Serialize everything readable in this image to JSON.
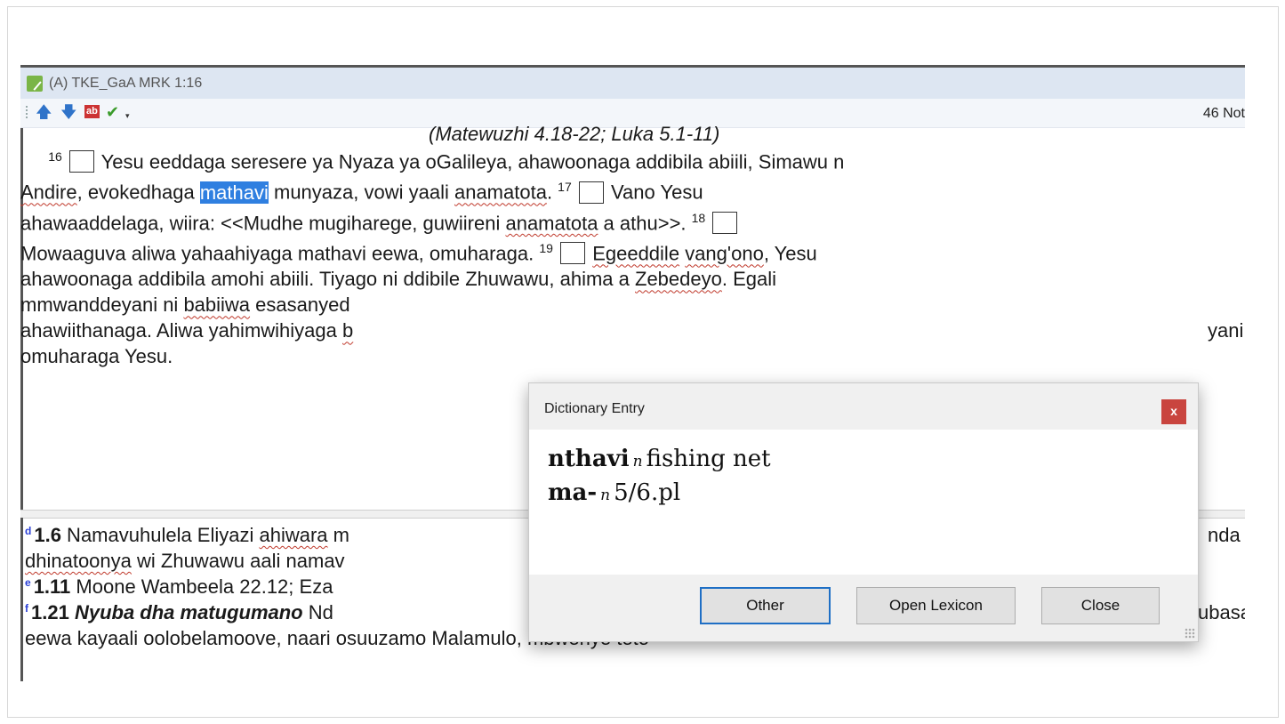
{
  "window": {
    "title": "(A) TKE_GaA MRK 1:16",
    "notes_count": "46 Not"
  },
  "toolbar": {
    "up_icon": "arrow-up-icon",
    "down_icon": "arrow-down-icon",
    "ab_label": "ab",
    "check_icon": "check-icon",
    "dropdown": "▾"
  },
  "editor": {
    "heading": "(Matewuzhi 4.18-22; Luka 5.1-11)",
    "lines": [
      {
        "v16": "16",
        "a": " Yesu eeddaga seresere ya Nyaza ya oGalileya, ahawoonaga addibila abiili, Simawu n"
      },
      {
        "a1": "Andire",
        "a2": ", evokedhaga ",
        "hl": "mathavi",
        "a3": " munyaza, vowi yaali ",
        "a4": "anamatota",
        "a5": ". ",
        "v17": "17",
        "a6": " Vano Yesu"
      },
      {
        "a1": "ahawaaddelaga, wiira: <<Mudhe mugiharege, guwiireni ",
        "a2": "anamatota",
        "a3": " a athu>>. ",
        "v18": "18"
      },
      {
        "a1": "Mowaaguva aliwa yahaahiyaga mathavi eewa, omuharaga. ",
        "v19": "19",
        "a2": "Egeeddile",
        "a3": " ",
        "a4": "vang'ono",
        "a5": ", Yesu"
      },
      {
        "a1": "ahawoonaga addibila amohi abiili. Tiyago ni ddibile Zhuwawu, ahima a ",
        "a2": "Zebedeyo",
        "a3": ". Egali"
      },
      {
        "a1": "mmwanddeyani ni ",
        "a2": "babiiwa",
        "a3": " esasanyed"
      },
      {
        "a1": "ahawiithanaga. Aliwa yahimwihiyaga ",
        "a2": "b",
        "a3": "yani,"
      },
      {
        "a1": "omuharaga Yesu."
      }
    ]
  },
  "notes": {
    "lines": [
      {
        "mk": "d",
        "ref": "1.6",
        "t1": " Namavuhulela Eliyazi ",
        "t2": "ahiwara",
        "t3": " m",
        "t4": "nda"
      },
      {
        "t1": "dhinatoonya",
        "t2": " wi Zhuwawu aali namav"
      },
      {
        "mk": "e",
        "ref": "1.11",
        "t1": " Moone Wambeela 22.12; Eza"
      },
      {
        "mk": "f",
        "ref": "1.21",
        "t1": " Nyuba dha matugumano",
        "t2": " Nd",
        "t3": "ubasa"
      },
      {
        "t1": "eewa kayaali oolobelamoove, naari osuuzamo Malamulo, mbwenye teto"
      }
    ]
  },
  "dialog": {
    "title": "Dictionary Entry",
    "close_x": "x",
    "entries": [
      {
        "word": "nthavi",
        "pos": "n",
        "gloss": "fishing net"
      },
      {
        "word": "ma-",
        "pos": "n",
        "gloss": "5/6.pl"
      }
    ],
    "buttons": {
      "other": "Other",
      "open_lexicon": "Open Lexicon",
      "close": "Close"
    }
  }
}
